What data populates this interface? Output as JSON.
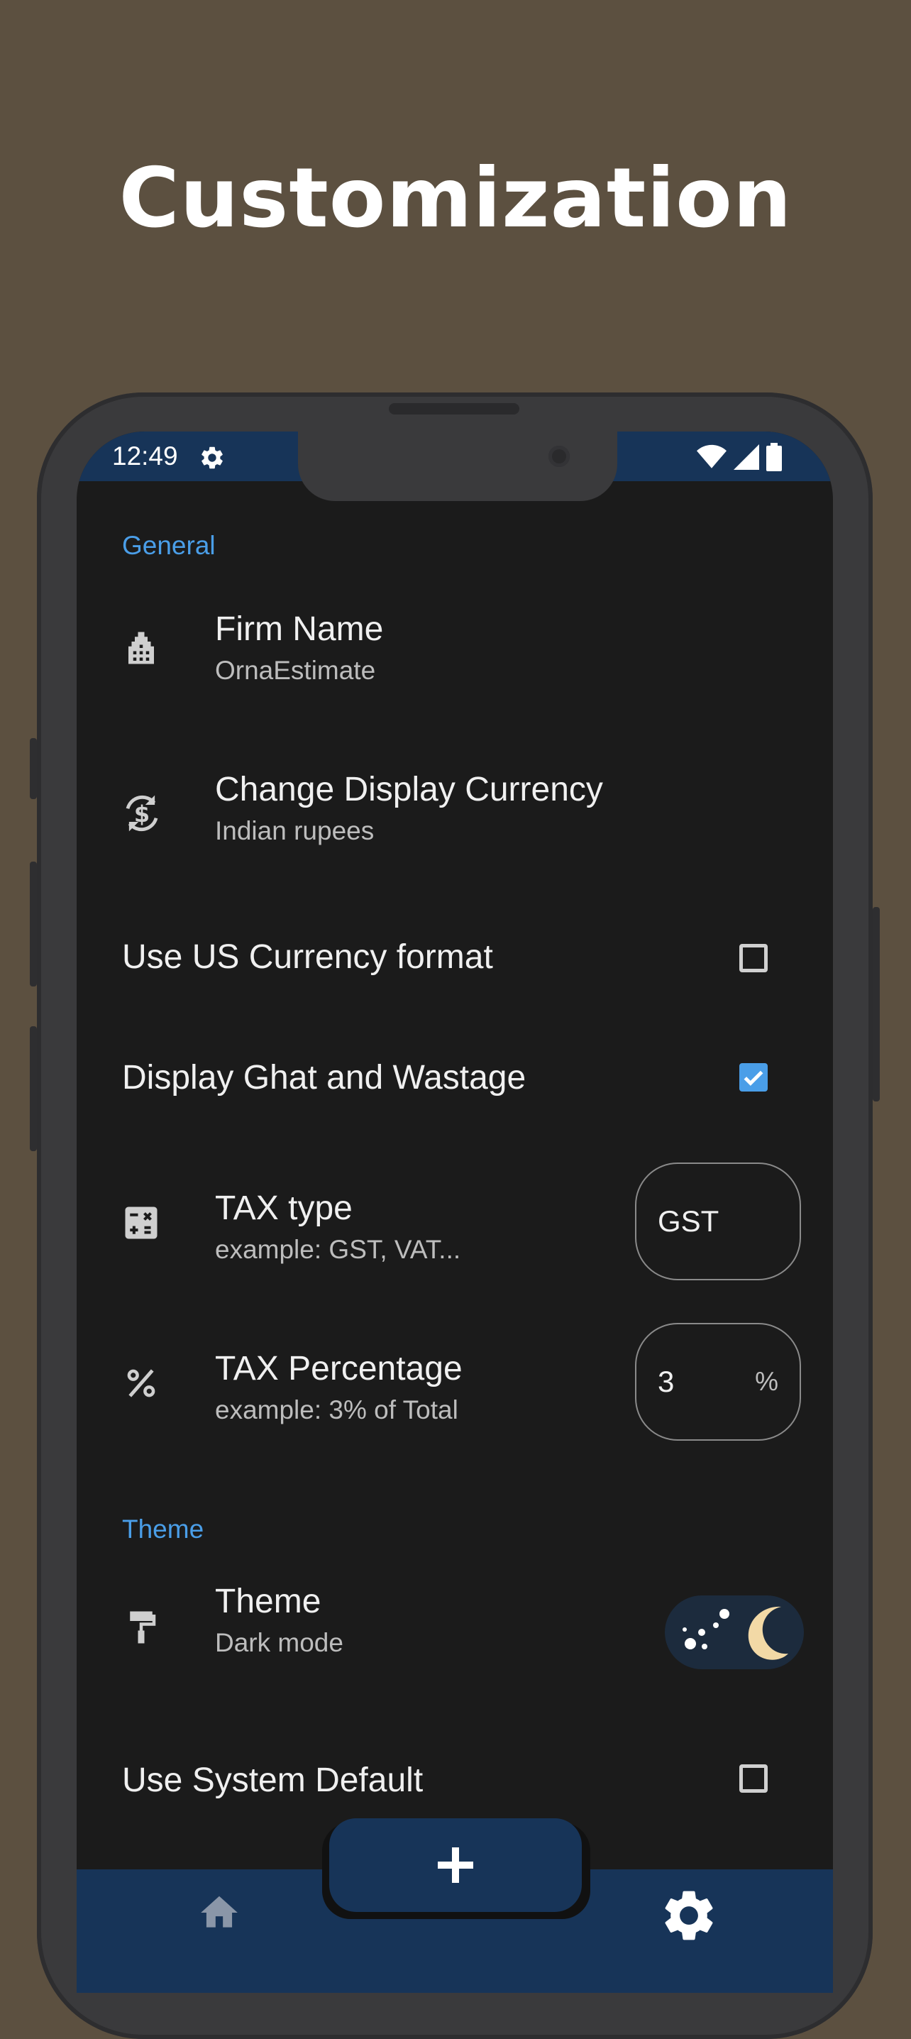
{
  "headline": "Customization",
  "status_bar": {
    "time": "12:49"
  },
  "sections": {
    "general": "General",
    "theme": "Theme"
  },
  "settings": {
    "firm_name": {
      "title": "Firm Name",
      "subtitle": "OrnaEstimate"
    },
    "display_currency": {
      "title": "Change Display Currency",
      "subtitle": "Indian rupees"
    },
    "us_currency_format": {
      "title": "Use US Currency format",
      "checked": false
    },
    "ghat_wastage": {
      "title": "Display Ghat and Wastage",
      "checked": true
    },
    "tax_type": {
      "title": "TAX type",
      "subtitle": "example: GST, VAT...",
      "value": "GST"
    },
    "tax_percentage": {
      "title": "TAX Percentage",
      "subtitle": "example: 3% of Total",
      "value": "3",
      "suffix": "%"
    },
    "theme": {
      "title": "Theme",
      "subtitle": "Dark mode",
      "dark_mode": true
    },
    "system_default": {
      "title": "Use System Default",
      "checked": false
    }
  },
  "bottom_nav": {
    "items": [
      {
        "icon": "home-icon",
        "active": false
      },
      {
        "icon": "add-icon"
      },
      {
        "icon": "settings-icon",
        "active": true
      }
    ]
  },
  "colors": {
    "background": "#5c5040",
    "screen": "#1b1b1b",
    "accent": "#4a9ee8",
    "nav_bar": "#173458"
  }
}
